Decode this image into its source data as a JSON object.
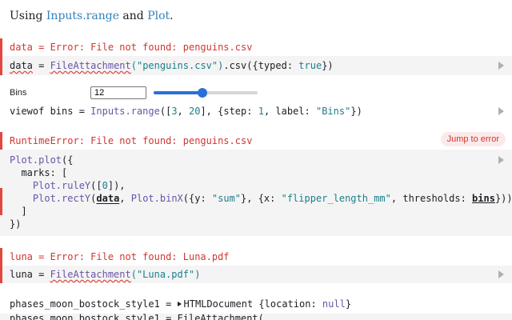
{
  "intro": {
    "prefix": "Using ",
    "link1": "Inputs.range",
    "middle": " and ",
    "link2": "Plot",
    "suffix": "."
  },
  "cells": {
    "data": {
      "error": "data = Error: File not found: penguins.csv",
      "code_name": "data",
      "code_eq": " = ",
      "code_fn": "FileAttachment",
      "code_str": "(\"penguins.csv\")",
      "code_rest1": ".csv({",
      "code_prop": "typed",
      "code_colon": ": ",
      "code_val": "true",
      "code_rest2": "})"
    },
    "bins": {
      "label": "Bins",
      "value": "12",
      "min": 3,
      "max": 20,
      "fraction": 0.47,
      "code_a": "viewof bins = ",
      "code_fn": "Inputs.range",
      "code_b": "([",
      "code_n1": "3",
      "code_c": ", ",
      "code_n2": "20",
      "code_d": "], {",
      "code_p1": "step",
      "code_e": ": ",
      "code_n3": "1",
      "code_f": ", ",
      "code_p2": "label",
      "code_g": ": ",
      "code_s": "\"Bins\"",
      "code_h": "})"
    },
    "plot": {
      "error": "RuntimeError: File not found: penguins.csv",
      "jump": "Jump to error",
      "l1_fn": "Plot.plot",
      "l1_rest": "({",
      "l2": "  marks: [",
      "l3_pre": "    ",
      "l3_fn": "Plot.ruleY",
      "l3_a": "([",
      "l3_n": "0",
      "l3_b": "]),",
      "l4_pre": "    ",
      "l4_fn": "Plot.rectY",
      "l4_a": "(",
      "l4_data": "data",
      "l4_b": ", ",
      "l4_fn2": "Plot.binX",
      "l4_c": "({y: ",
      "l4_s1": "\"sum\"",
      "l4_d": "}, {x: ",
      "l4_s2": "\"flipper_length_mm\"",
      "l4_e": ", thresholds: ",
      "l4_bins": "bins",
      "l4_f": "}))",
      "l5": "  ]",
      "l6": "})"
    },
    "luna": {
      "error": "luna = Error: File not found: Luna.pdf",
      "code_a": "luna = ",
      "code_fn": "FileAttachment",
      "code_str": "(\"Luna.pdf\")"
    },
    "phases": {
      "a": "phases_moon_bostock_style1 = ",
      "b": "HTMLDocument {",
      "c": "location",
      "d": ": ",
      "e": "null",
      "f": "}",
      "next": "phases_moon_bostock_style1 = FileAttachment("
    }
  }
}
